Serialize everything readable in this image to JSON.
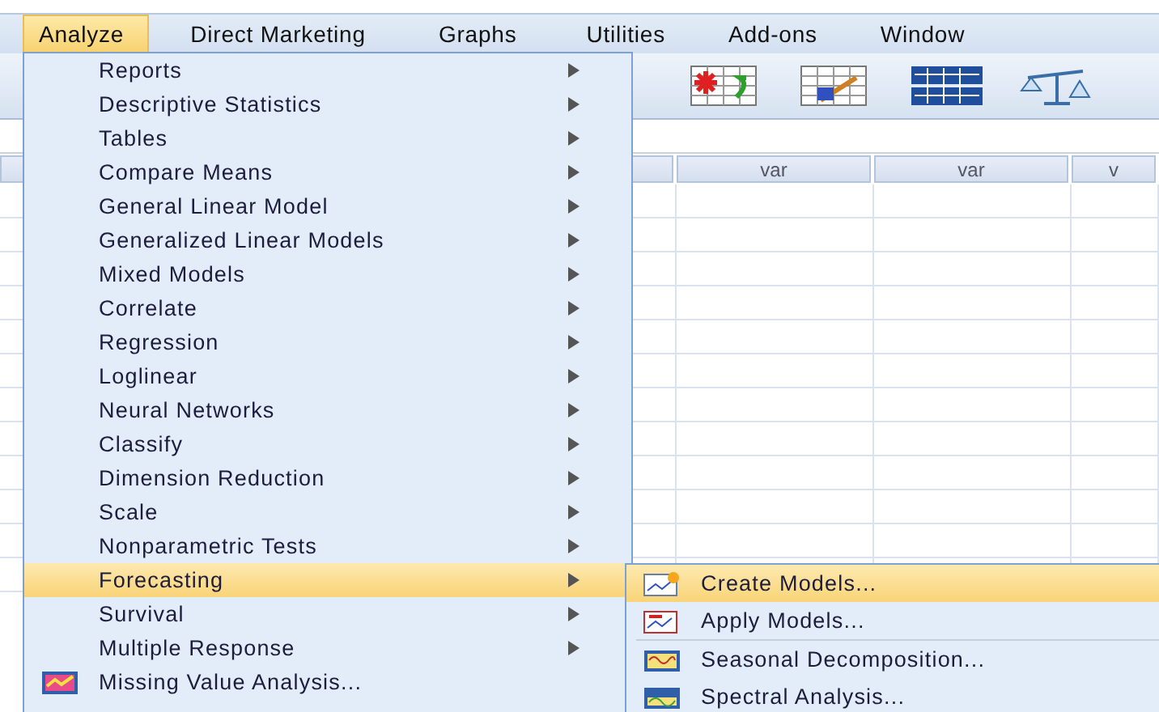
{
  "menu_bar": [
    {
      "label": "Analyze",
      "selected": true
    },
    {
      "label": "Direct Marketing",
      "selected": false
    },
    {
      "label": "Graphs",
      "selected": false
    },
    {
      "label": "Utilities",
      "selected": false
    },
    {
      "label": "Add-ons",
      "selected": false
    },
    {
      "label": "Window",
      "selected": false
    }
  ],
  "data_grid": {
    "columns": [
      "var",
      "var",
      "v"
    ]
  },
  "analyze_menu": {
    "items": [
      {
        "label": "Reports",
        "kind": "submenu",
        "selected": false
      },
      {
        "label": "Descriptive Statistics",
        "kind": "submenu",
        "selected": false
      },
      {
        "label": "Tables",
        "kind": "submenu",
        "selected": false
      },
      {
        "label": "Compare Means",
        "kind": "submenu",
        "selected": false
      },
      {
        "label": "General Linear Model",
        "kind": "submenu",
        "selected": false
      },
      {
        "label": "Generalized Linear Models",
        "kind": "submenu",
        "selected": false
      },
      {
        "label": "Mixed Models",
        "kind": "submenu",
        "selected": false
      },
      {
        "label": "Correlate",
        "kind": "submenu",
        "selected": false
      },
      {
        "label": "Regression",
        "kind": "submenu",
        "selected": false
      },
      {
        "label": "Loglinear",
        "kind": "submenu",
        "selected": false
      },
      {
        "label": "Neural Networks",
        "kind": "submenu",
        "selected": false
      },
      {
        "label": "Classify",
        "kind": "submenu",
        "selected": false
      },
      {
        "label": "Dimension Reduction",
        "kind": "submenu",
        "selected": false
      },
      {
        "label": "Scale",
        "kind": "submenu",
        "selected": false
      },
      {
        "label": "Nonparametric Tests",
        "kind": "submenu",
        "selected": false
      },
      {
        "label": "Forecasting",
        "kind": "submenu",
        "selected": true
      },
      {
        "label": "Survival",
        "kind": "submenu",
        "selected": false
      },
      {
        "label": "Multiple Response",
        "kind": "submenu",
        "selected": false
      },
      {
        "label": "Missing Value Analysis...",
        "kind": "command",
        "selected": false
      }
    ]
  },
  "forecasting_menu": {
    "items": [
      {
        "label": "Create Models...",
        "kind": "command",
        "selected": true
      },
      {
        "label": "Apply Models...",
        "kind": "command",
        "selected": false
      },
      {
        "kind": "separator"
      },
      {
        "label": "Seasonal Decomposition...",
        "kind": "command",
        "selected": false
      },
      {
        "label": "Spectral Analysis...",
        "kind": "command",
        "selected": false
      }
    ]
  }
}
